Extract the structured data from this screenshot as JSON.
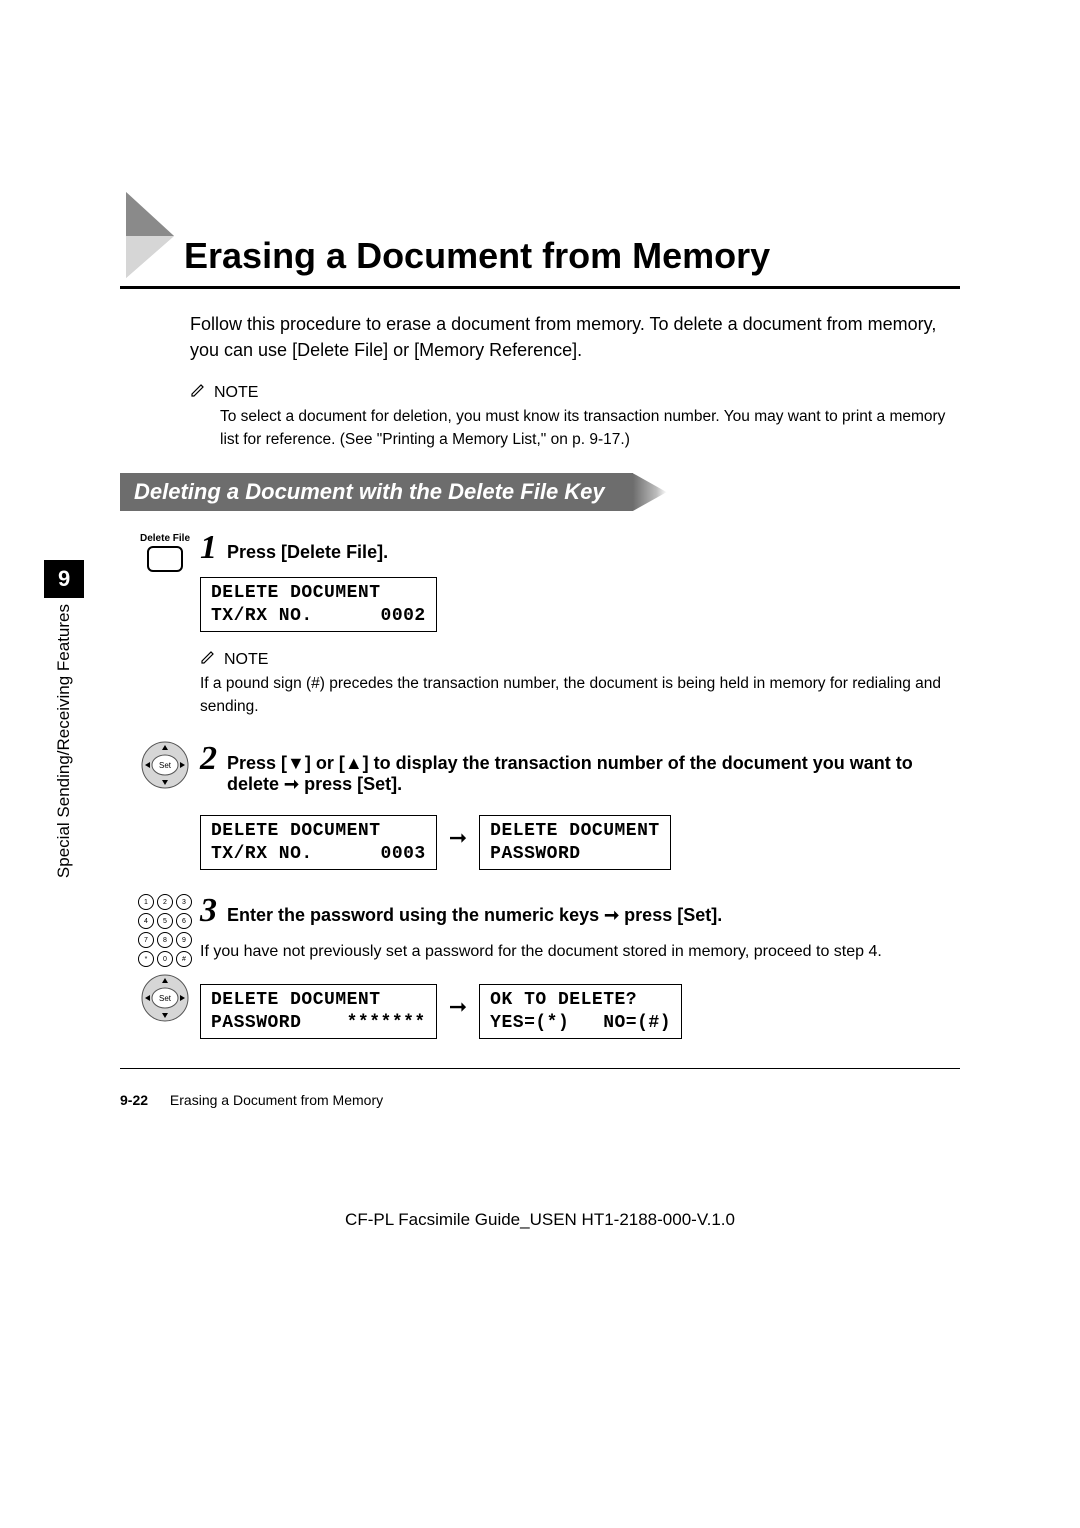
{
  "title": "Erasing a Document from Memory",
  "intro": "Follow this procedure to erase a document from memory. To delete a document from memory, you can use [Delete File] or [Memory Reference].",
  "note1_label": "NOTE",
  "note1_text": "To select a document for deletion, you must know its transaction number. You may want to print a memory list for reference. (See \"Printing a Memory List,\" on p. 9-17.)",
  "section_heading": "Deleting a Document with the Delete File Key",
  "sidebar": {
    "label": "Special Sending/Receiving Features",
    "chapter_num": "9"
  },
  "steps": {
    "s1": {
      "num": "1",
      "icon_label": "Delete File",
      "title": "Press [Delete File].",
      "lcd1_line1": "DELETE DOCUMENT",
      "lcd1_line2": "TX/RX NO.      0002",
      "note_label": "NOTE",
      "note_text": "If a pound sign (#) precedes the transaction number, the document is being held in memory for redialing and sending."
    },
    "s2": {
      "num": "2",
      "title": "Press [▼] or [▲] to display the transaction number of the document you want to delete ➞ press [Set].",
      "lcd1_line1": "DELETE DOCUMENT",
      "lcd1_line2": "TX/RX NO.      0003",
      "arrow": "➞",
      "lcd2_line1": "DELETE DOCUMENT",
      "lcd2_line2": "PASSWORD"
    },
    "s3": {
      "num": "3",
      "title": "Enter the password using the numeric keys ➞ press [Set].",
      "detail": "If you have not previously set a password for the document stored in memory, proceed to step 4.",
      "lcd1_line1": "DELETE DOCUMENT",
      "lcd1_line2": "PASSWORD    *******",
      "arrow": "➞",
      "lcd2_line1": "OK TO DELETE?",
      "lcd2_line2": "YES=(*)   NO=(#)"
    }
  },
  "keypad": [
    "1",
    "2",
    "3",
    "4",
    "5",
    "6",
    "7",
    "8",
    "9",
    "*",
    "0",
    "#"
  ],
  "footer": {
    "page_num": "9-22",
    "page_title": "Erasing a Document from Memory"
  },
  "doc_meta": "CF-PL Facsimile Guide_USEN HT1-2188-000-V.1.0"
}
